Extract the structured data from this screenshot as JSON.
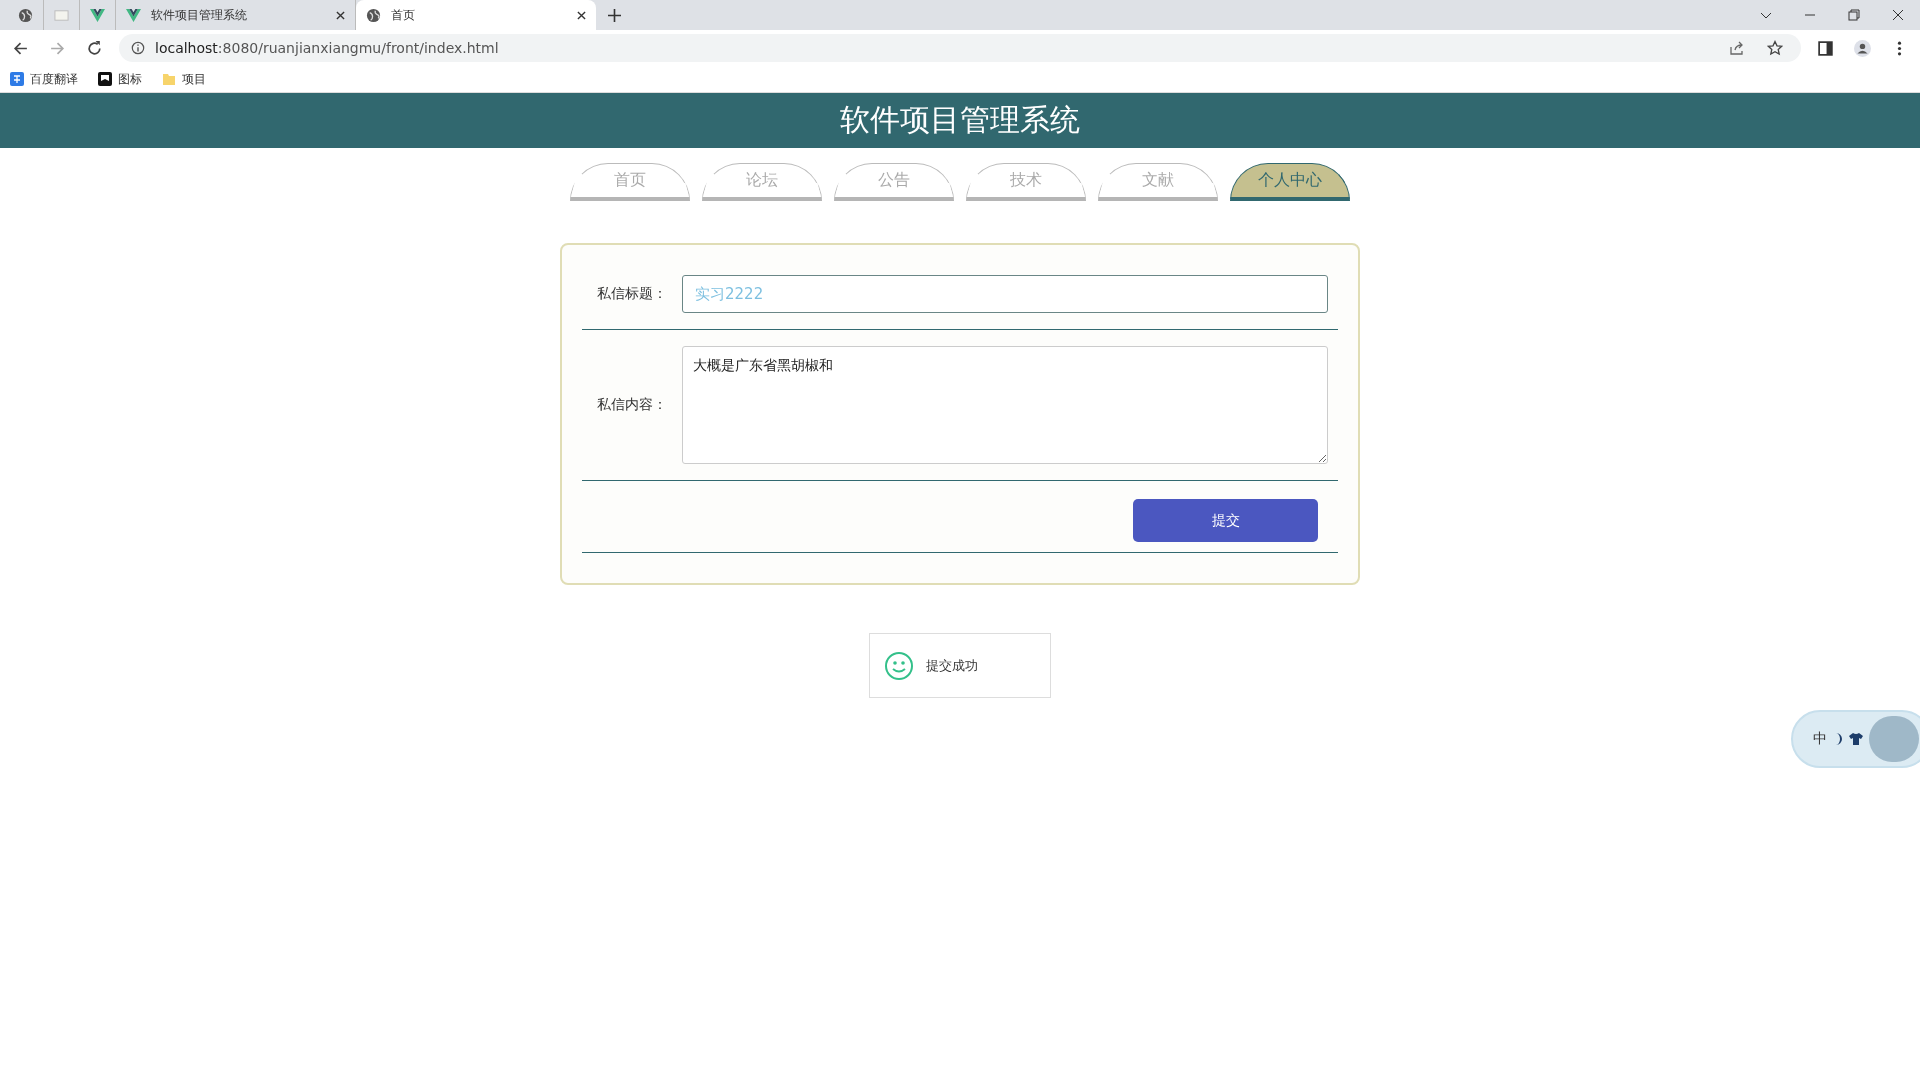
{
  "browser": {
    "tabs": [
      {
        "kind": "globe",
        "selected": false
      },
      {
        "kind": "page",
        "selected": false
      },
      {
        "kind": "vue",
        "selected": false
      },
      {
        "kind": "vue",
        "label": "软件项目管理系统",
        "selected": false
      },
      {
        "kind": "globe",
        "label": "首页",
        "selected": true
      }
    ],
    "url_host": "localhost",
    "url_rest": ":8080/ruanjianxiangmu/front/index.html",
    "bookmarks": [
      {
        "kind": "translate",
        "label": "百度翻译"
      },
      {
        "kind": "image",
        "label": "图标"
      },
      {
        "kind": "folder",
        "label": "项目"
      }
    ]
  },
  "header": {
    "title": "软件项目管理系统"
  },
  "nav": [
    {
      "label": "首页",
      "selected": false
    },
    {
      "label": "论坛",
      "selected": false
    },
    {
      "label": "公告",
      "selected": false
    },
    {
      "label": "技术",
      "selected": false
    },
    {
      "label": "文献",
      "selected": false
    },
    {
      "label": "个人中心",
      "selected": true
    }
  ],
  "form": {
    "fields": [
      {
        "kind": "input",
        "label": "私信标题：",
        "value": "实习2222"
      },
      {
        "kind": "textarea",
        "label": "私信内容：",
        "value": "大概是广东省黑胡椒和"
      }
    ],
    "submit": "提交"
  },
  "toast": {
    "message": "提交成功"
  },
  "ime_widget": {
    "label": "中"
  }
}
